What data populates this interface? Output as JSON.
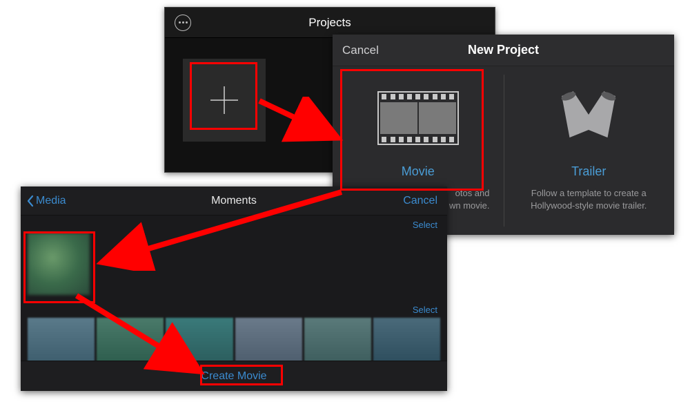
{
  "projects": {
    "title": "Projects"
  },
  "new_project": {
    "cancel": "Cancel",
    "title": "New Project",
    "movie": {
      "label": "Movie",
      "desc_fragment": "otos and\nwn movie."
    },
    "trailer": {
      "label": "Trailer",
      "desc": "Follow a template to create a Hollywood-style movie trailer."
    }
  },
  "moments": {
    "back": "Media",
    "title": "Moments",
    "cancel": "Cancel",
    "select": "Select",
    "create": "Create Movie"
  },
  "annotations": {
    "color": "#FF0000"
  }
}
